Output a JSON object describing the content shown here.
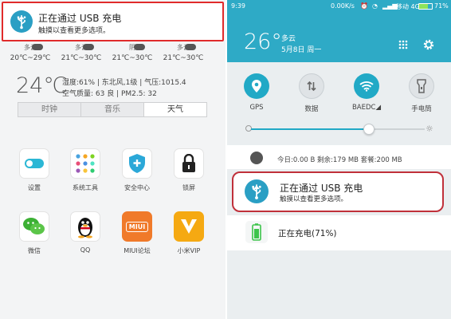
{
  "left": {
    "notification": {
      "title": "正在通过 USB 充电",
      "subtitle": "触摸以查看更多选项。"
    },
    "forecast": [
      {
        "condition": "多云",
        "range": "20℃~29℃"
      },
      {
        "condition": "多云",
        "range": "21℃~30℃"
      },
      {
        "condition": "阴",
        "range": "21℃~30℃"
      },
      {
        "condition": "多云",
        "range": "21℃~30℃"
      }
    ],
    "weather": {
      "temp": "24℃",
      "line1": "湿度:61% | 东北风,1级 | 气压:1015.4",
      "line2": "空气质量: 63 良 | PM2.5: 32"
    },
    "tabs": [
      "时钟",
      "音乐",
      "天气"
    ],
    "apps": [
      {
        "label": "设置",
        "icon": "toggle-icon"
      },
      {
        "label": "系统工具",
        "icon": "tools-grid-icon"
      },
      {
        "label": "安全中心",
        "icon": "shield-icon"
      },
      {
        "label": "锁屏",
        "icon": "lock-icon"
      },
      {
        "label": "微信",
        "icon": "wechat-icon"
      },
      {
        "label": "QQ",
        "icon": "qq-penguin-icon"
      },
      {
        "label": "MIUI论坛",
        "icon": "miui-forum-icon"
      },
      {
        "label": "小米VIP",
        "icon": "vip-v-icon"
      }
    ],
    "miui_badge": "MIUI"
  },
  "right": {
    "statusbar": {
      "time": "9:39",
      "speed": "0.00K/s",
      "carrier": "移动 4G",
      "battery": "71%"
    },
    "weather": {
      "temp": "26°",
      "condition": "多云",
      "date": "5月8日 周一"
    },
    "toggles": [
      {
        "label": "GPS",
        "icon": "location-pin-icon",
        "on": true
      },
      {
        "label": "数据",
        "icon": "data-arrows-icon",
        "on": false
      },
      {
        "label": "BAEDC◢",
        "icon": "wifi-icon",
        "on": true
      },
      {
        "label": "手电筒",
        "icon": "flashlight-icon",
        "on": false
      }
    ],
    "brightness": 0.68,
    "traffic": "今日:0.00 B   剩余:179 MB   套餐:200 MB",
    "notification": {
      "title": "正在通过 USB 充电",
      "subtitle": "触摸以查看更多选项。"
    },
    "charging": "正在充电(71%)"
  },
  "colors": {
    "accent": "#21a9c6",
    "header": "#2eaac6",
    "highlight": "#e02b2b"
  }
}
